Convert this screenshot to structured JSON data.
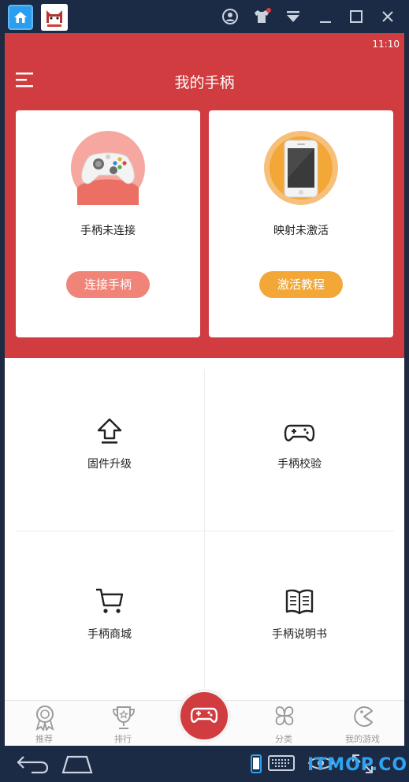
{
  "status": {
    "time": "11:10"
  },
  "header": {
    "title": "我的手柄"
  },
  "cards": [
    {
      "label": "手柄未连接",
      "button": "连接手柄",
      "button_color": "#f08479",
      "circle_color": "#f6a79f"
    },
    {
      "label": "映射未激活",
      "button": "激活教程",
      "button_color": "#f2a737",
      "circle_color": "#f6c07a"
    }
  ],
  "grid": {
    "items": [
      {
        "label": "固件升级",
        "icon": "upload-arrow-icon"
      },
      {
        "label": "手柄校验",
        "icon": "gamepad-icon"
      },
      {
        "label": "手柄商城",
        "icon": "shopping-cart-icon"
      },
      {
        "label": "手柄说明书",
        "icon": "book-icon"
      }
    ]
  },
  "bottom_nav": {
    "items": [
      {
        "label": "推荐",
        "icon": "medal-icon"
      },
      {
        "label": "排行",
        "icon": "trophy-icon"
      },
      {
        "label": "分类",
        "icon": "category-icon"
      },
      {
        "label": "我的游戏",
        "icon": "pacman-icon"
      }
    ],
    "center_icon": "gamepad-icon"
  },
  "watermark": "ITMOP.COM",
  "colors": {
    "primary": "#d03c3f",
    "emulator_bar": "#1c2b45"
  }
}
